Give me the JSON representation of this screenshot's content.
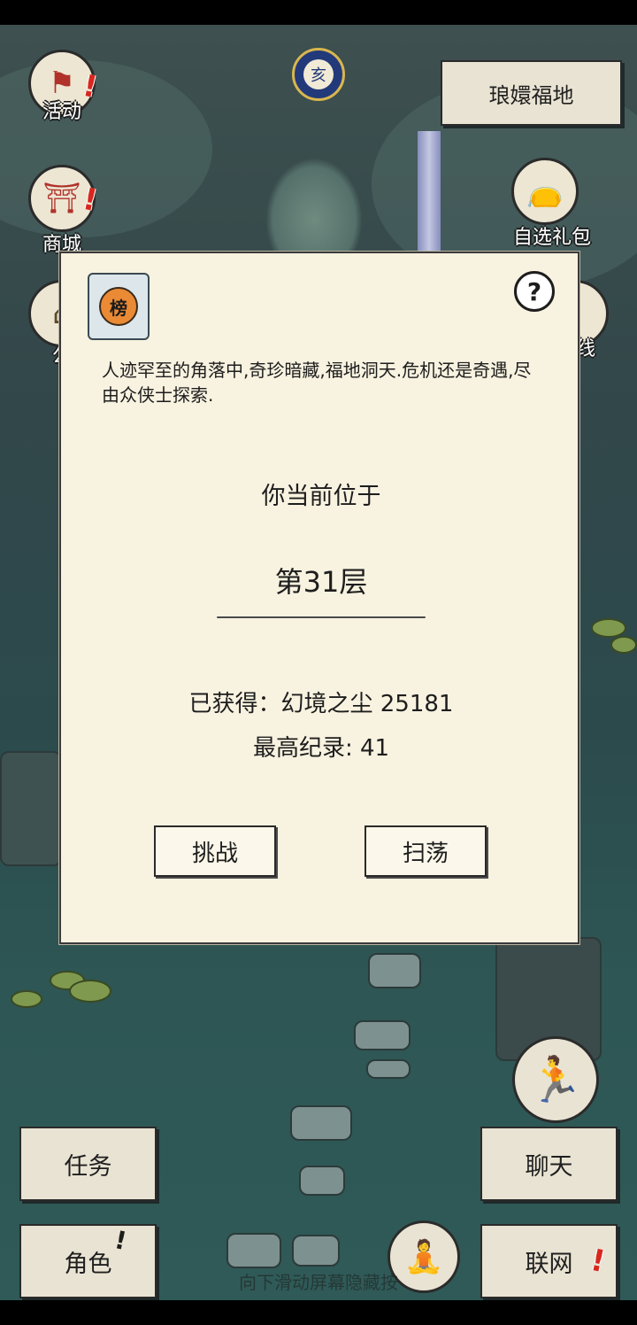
{
  "left_menu": [
    {
      "label": "活动",
      "icon": "banner-icon",
      "alert": "!"
    },
    {
      "label": "商城",
      "icon": "shop-icon",
      "alert": "!"
    },
    {
      "label": "公",
      "icon": "pavilion-icon"
    }
  ],
  "zodiac": {
    "glyph": "亥"
  },
  "location_button": {
    "label": "琅嬛福地"
  },
  "right_menu": [
    {
      "label": "自选礼包",
      "icon": "gift-bag-icon"
    },
    {
      "label": "线",
      "icon": "online-icon"
    }
  ],
  "modal": {
    "badge_glyph": "榜",
    "help_glyph": "?",
    "description": "人迹罕至的角落中,奇珍暗藏,福地洞天.危机还是奇遇,尽由众侠士探索.",
    "location_label": "你当前位于",
    "floor": "第31层",
    "obtained": "已获得：幻境之尘 25181",
    "best_record": "最高纪录: 41",
    "challenge_label": "挑战",
    "sweep_label": "扫荡"
  },
  "bottom_menu": {
    "tasks_label": "任务",
    "chat_label": "聊天",
    "role_label": "角色",
    "role_alert": "!",
    "network_label": "联网",
    "network_alert": "!"
  },
  "hint": "向下滑动屏幕隐藏按",
  "colors": {
    "panel": "#f8f2e0",
    "button": "#e9e3d3",
    "alert": "#d8271e",
    "water": "#2d5654"
  }
}
